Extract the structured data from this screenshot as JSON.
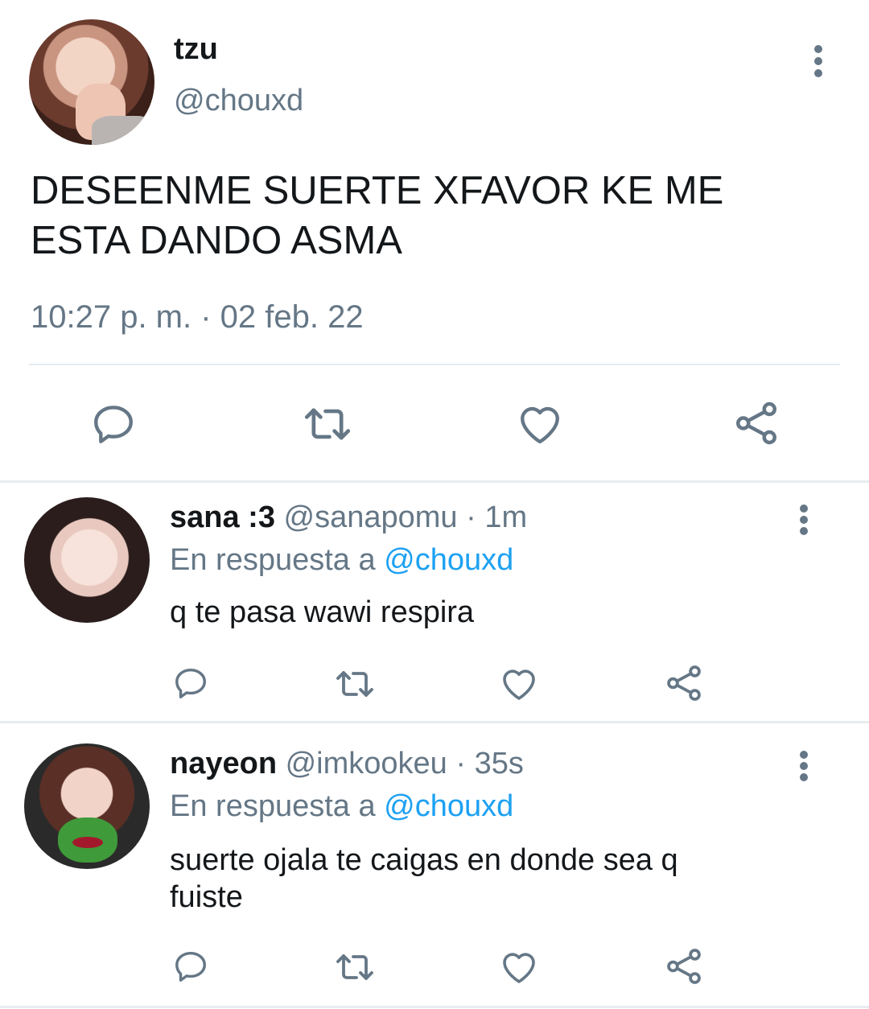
{
  "tweet": {
    "display_name": "tzu",
    "handle": "@chouxd",
    "text": "DESEENME SUERTE XFAVOR KE ME\nESTA DANDO ASMA",
    "timestamp": "10:27 p. m. · 02 feb. 22",
    "actions": [
      "reply-icon",
      "retweet-icon",
      "like-icon",
      "share-icon"
    ]
  },
  "replies": [
    {
      "display_name": "sana :3",
      "handle": "@sanapomu",
      "separator": "·",
      "time": "1m",
      "in_reply_prefix": "En respuesta a",
      "in_reply_to": "@chouxd",
      "text": "q te pasa wawi respira"
    },
    {
      "display_name": "nayeon",
      "handle": "@imkookeu",
      "separator": "·",
      "time": "35s",
      "in_reply_prefix": "En respuesta a",
      "in_reply_to": "@chouxd",
      "text": "suerte ojala te caigas en donde sea q fuiste"
    }
  ],
  "colors": {
    "text_primary": "#14171a",
    "text_secondary": "#657786",
    "link": "#1da1f2",
    "divider": "#e6ecf0"
  }
}
